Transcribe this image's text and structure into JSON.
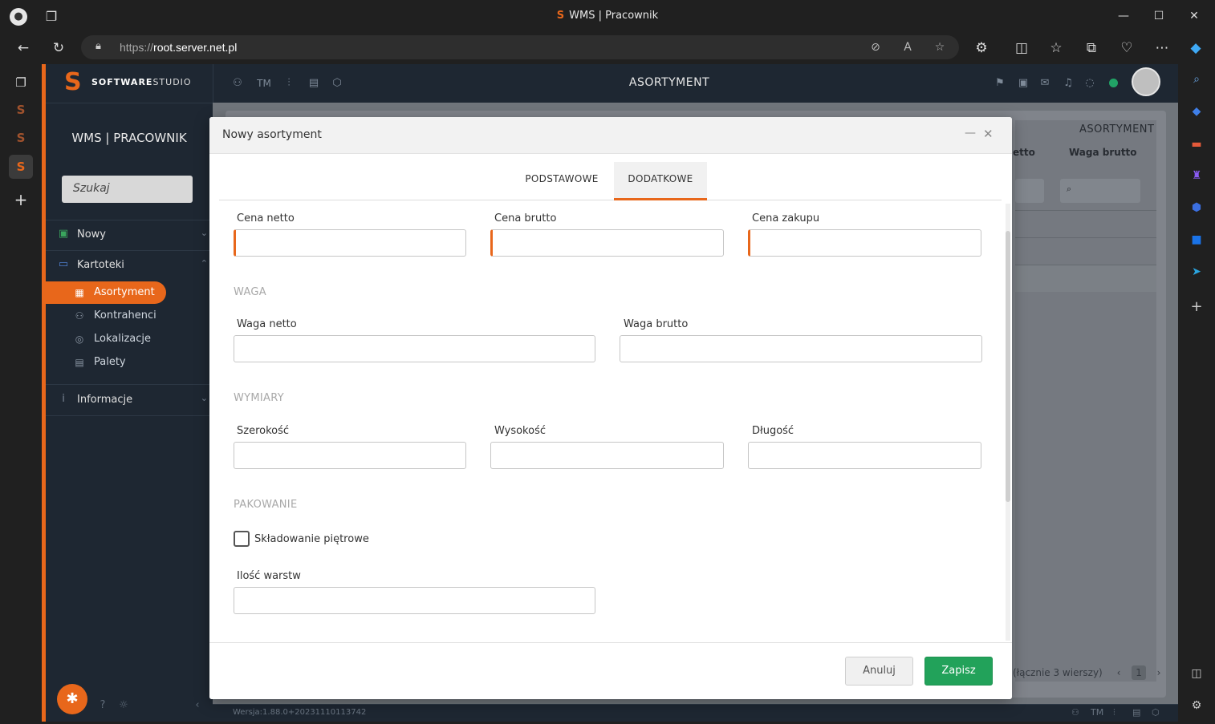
{
  "browser": {
    "tab_title": "WMS | Pracownik",
    "url_prefix": "https://",
    "url_host": "root.server.net.pl"
  },
  "app": {
    "brand_bold": "SOFTWARE",
    "brand_light": "STUDIO",
    "module_title": "WMS | PRACOWNIK",
    "search_placeholder": "Szukaj",
    "page_title": "ASORTYMENT",
    "menu": {
      "nowy": "Nowy",
      "kartoteki": "Kartoteki",
      "informacje": "Informacje",
      "sub": [
        "Asortyment",
        "Kontrahenci",
        "Lokalizacje",
        "Palety"
      ]
    },
    "topbar_text_icon": "TM",
    "status_color": "#21a366",
    "accent_color": "#e8671b"
  },
  "background": {
    "card_title": "ASORTYMENT",
    "col_netto": "etto",
    "col_brutto": "Waga brutto",
    "pager_text": "(łącznie 3 wierszy)",
    "page_no": "1",
    "version": "Wersja:1.88.0+20231110113742"
  },
  "modal": {
    "title": "Nowy asortyment",
    "tabs": [
      "PODSTAWOWE",
      "DODATKOWE"
    ],
    "active_tab": "DODATKOWE",
    "fields": {
      "cena_netto": "Cena netto",
      "cena_brutto": "Cena brutto",
      "cena_zakupu": "Cena zakupu",
      "waga_netto": "Waga netto",
      "waga_brutto": "Waga brutto",
      "szerokosc": "Szerokość",
      "wysokosc": "Wysokość",
      "dlugosc": "Długość",
      "skladowanie": "Składowanie piętrowe",
      "ilosc_warstw": "Ilość warstw"
    },
    "sections": {
      "waga": "WAGA",
      "wymiary": "WYMIARY",
      "pakowanie": "PAKOWANIE"
    },
    "buttons": {
      "cancel": "Anuluj",
      "save": "Zapisz"
    }
  }
}
